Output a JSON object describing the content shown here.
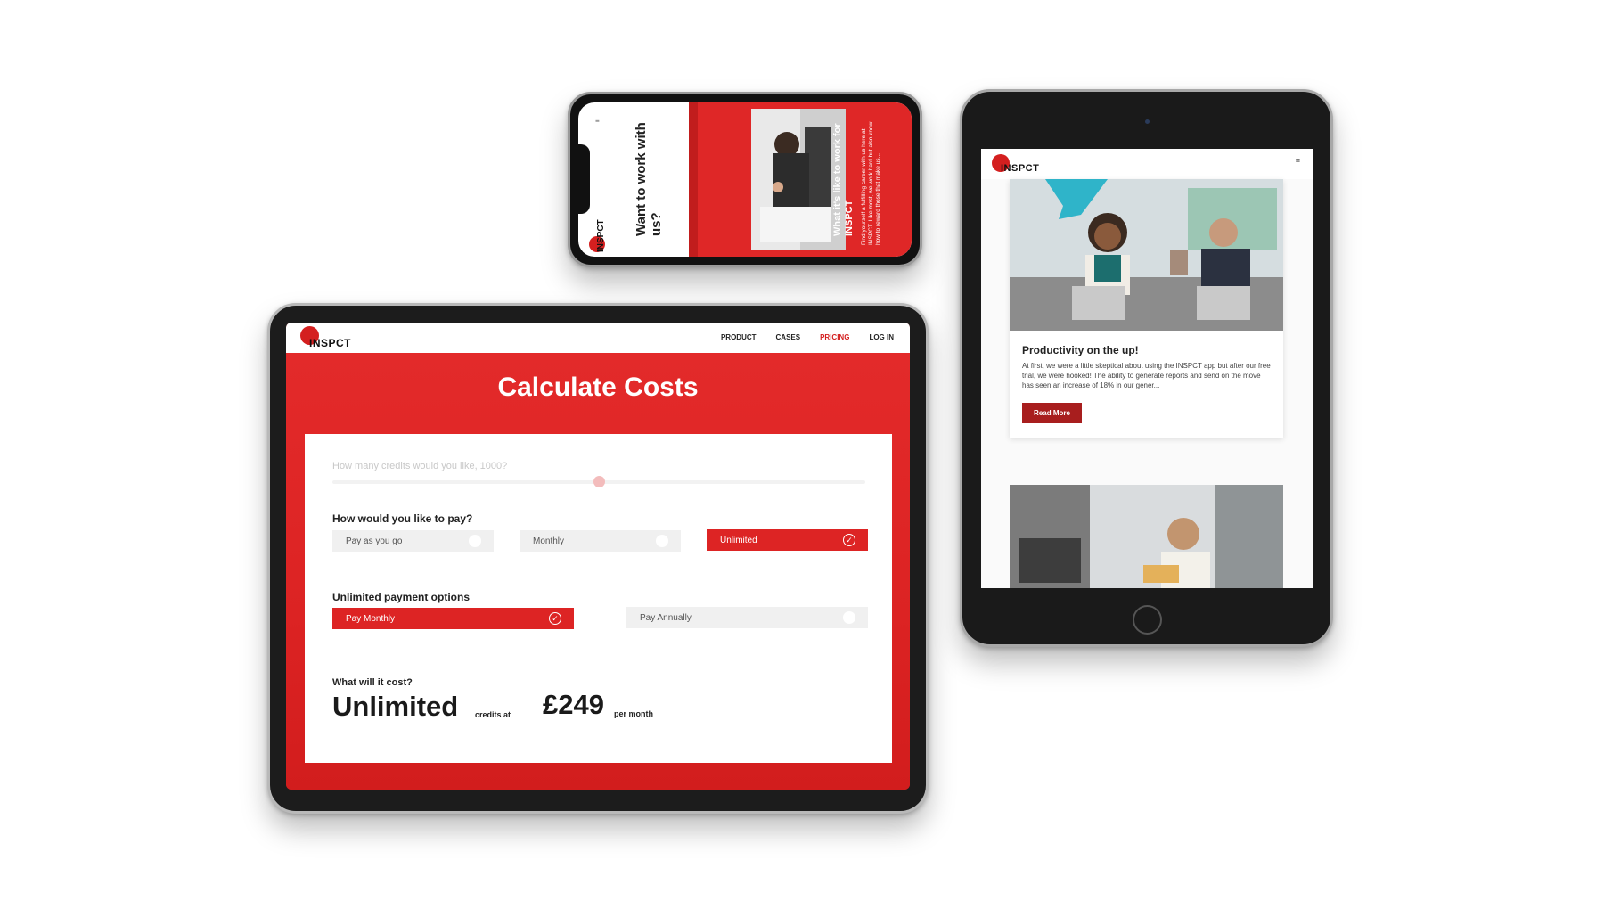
{
  "brand": {
    "logo_prefix": "IN",
    "logo_suffix": "SPCT",
    "accent": "#dd2424"
  },
  "landscape_tablet": {
    "nav": [
      {
        "label": "PRODUCT",
        "active": false
      },
      {
        "label": "CASES",
        "active": false
      },
      {
        "label": "PRICING",
        "active": true
      },
      {
        "label": "LOG IN",
        "active": false
      }
    ],
    "title": "Calculate Costs",
    "credits_question": "How many credits would you like, 1000?",
    "slider_fraction": 0.5,
    "pay_question": "How would you like to pay?",
    "pay_options": [
      {
        "label": "Pay as you go",
        "selected": false
      },
      {
        "label": "Monthly",
        "selected": false
      },
      {
        "label": "Unlimited",
        "selected": true
      }
    ],
    "unlimited_heading": "Unlimited payment options",
    "unlimited_options": [
      {
        "label": "Pay Monthly",
        "selected": true
      },
      {
        "label": "Pay Annually",
        "selected": false
      }
    ],
    "cost_question": "What will it cost?",
    "cost_amount": "Unlimited",
    "cost_credits_at": "credits at",
    "cost_price": "£249",
    "cost_period": "per month"
  },
  "phone": {
    "heading": "Want to work with us?",
    "red_heading": "What it's like to work for INSPCT",
    "red_body": "Find yourself a fulfilling career with us here at INSPCT. Like most, we work hard but also know how to reward those that make us..."
  },
  "portrait_tablet": {
    "card_title": "Productivity on the up!",
    "card_body": "At first, we were a little skeptical about using the INSPCT app but after our free trial, we were hooked! The ability to generate reports and send on the move has seen an increase of 18% in our gener...",
    "read_more": "Read More",
    "menu_icon": "hamburger-icon"
  }
}
